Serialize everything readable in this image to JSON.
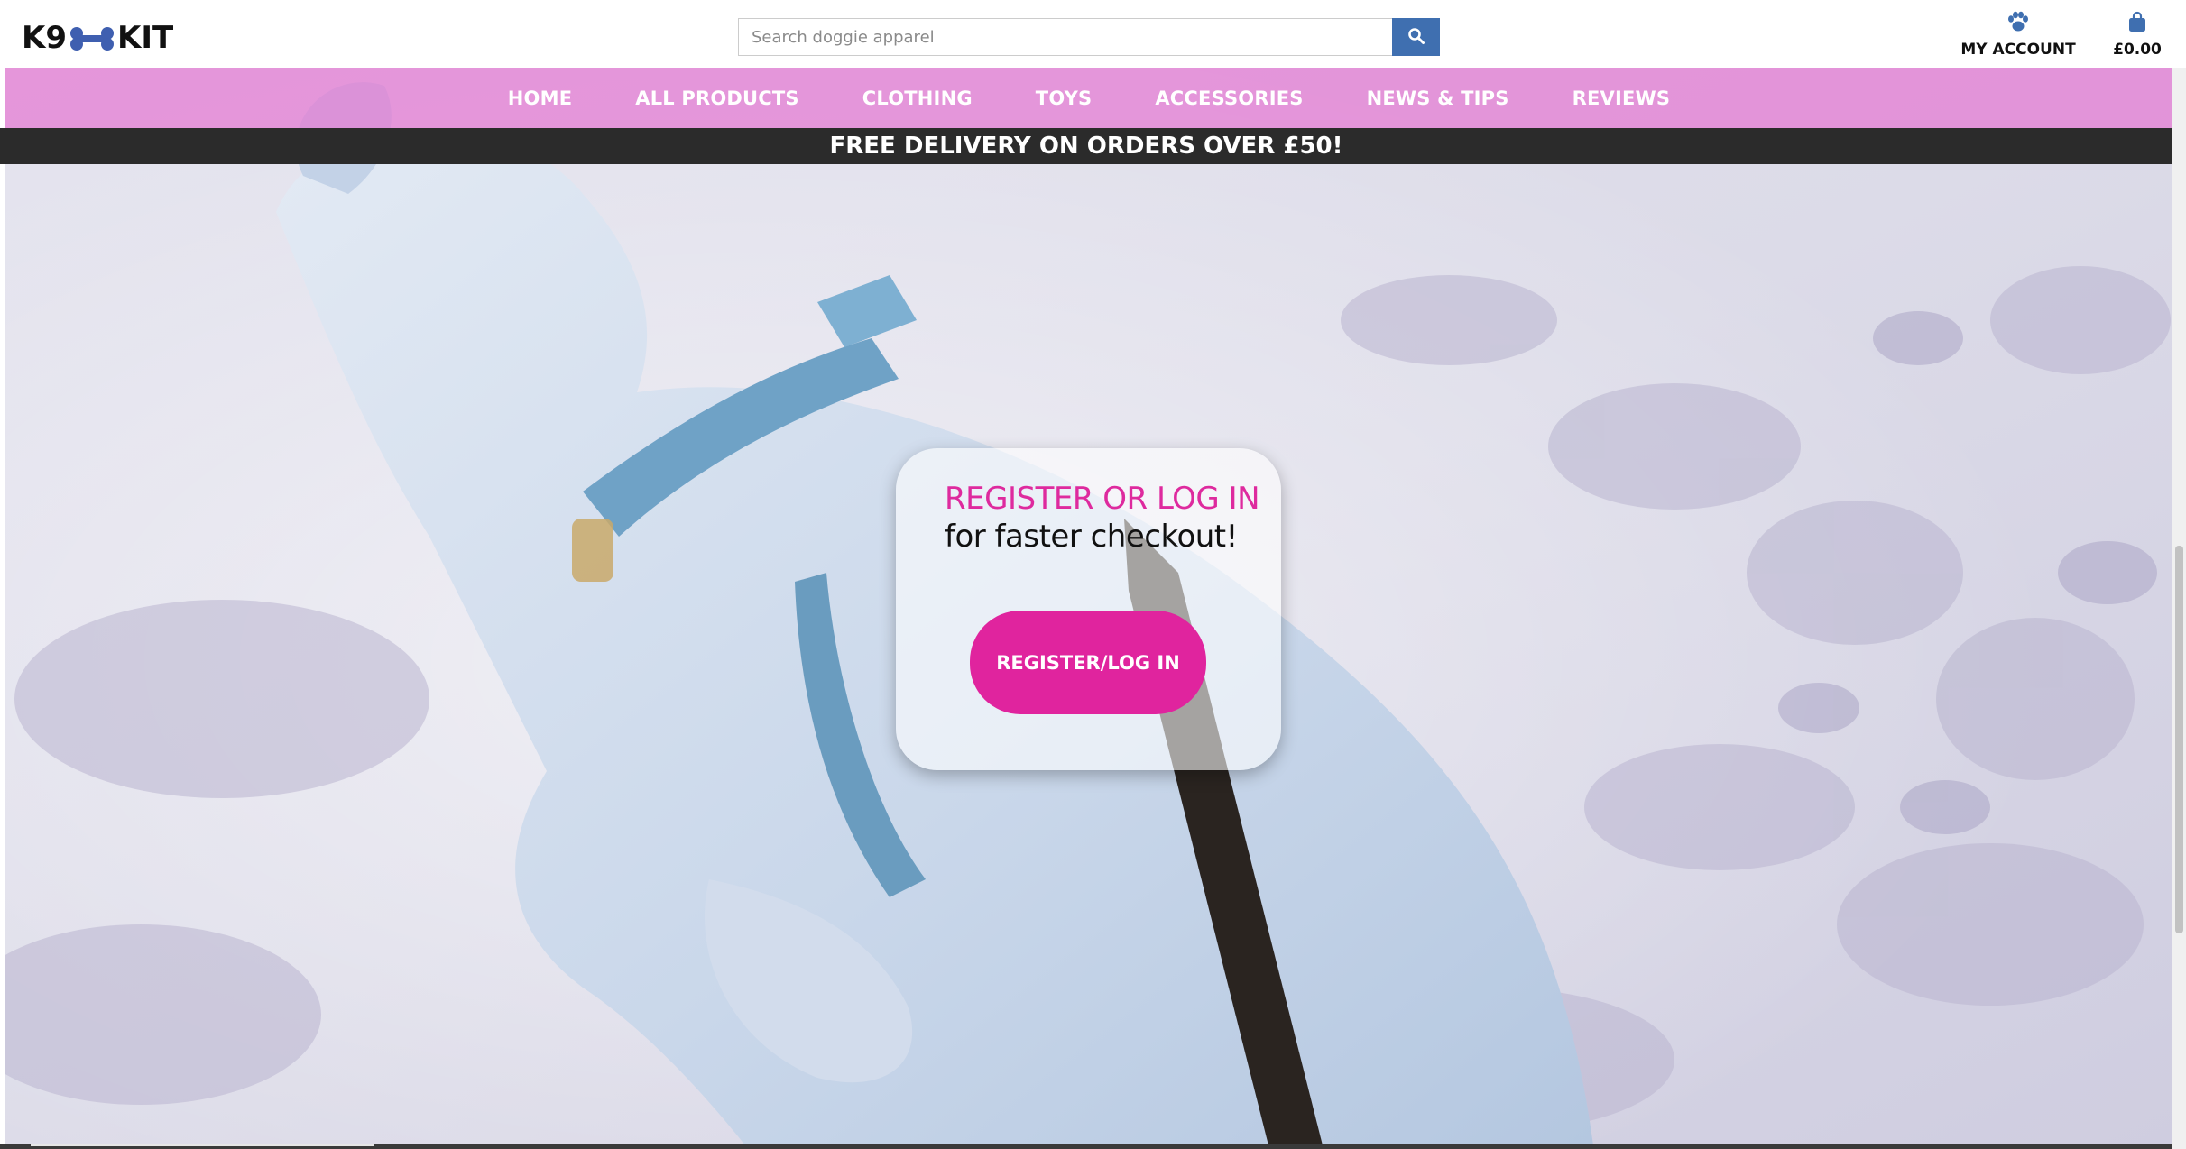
{
  "header": {
    "logo_left": "K9",
    "logo_right": "KIT",
    "search": {
      "placeholder": "Search doggie apparel",
      "value": "",
      "button_icon": "search-icon"
    },
    "account": {
      "label": "MY ACCOUNT",
      "icon": "paw-icon"
    },
    "cart": {
      "total": "£0.00",
      "icon": "shopping-bag-icon"
    }
  },
  "nav": {
    "items": [
      "HOME",
      "ALL PRODUCTS",
      "CLOTHING",
      "TOYS",
      "ACCESSORIES",
      "NEWS & TIPS",
      "REVIEWS"
    ]
  },
  "promo": {
    "text": "FREE DELIVERY ON ORDERS OVER £50!"
  },
  "login_card": {
    "heading": "REGISTER OR LOG IN",
    "subheading": "for faster checkout!",
    "button_label": "REGISTER/LOG IN"
  },
  "colors": {
    "accent_pink": "#e0249e",
    "heading_pink": "#de2a9e",
    "nav_pink": "#e478d2",
    "search_blue": "#3f6fb0",
    "promo_bar": "#2b2b2b"
  }
}
